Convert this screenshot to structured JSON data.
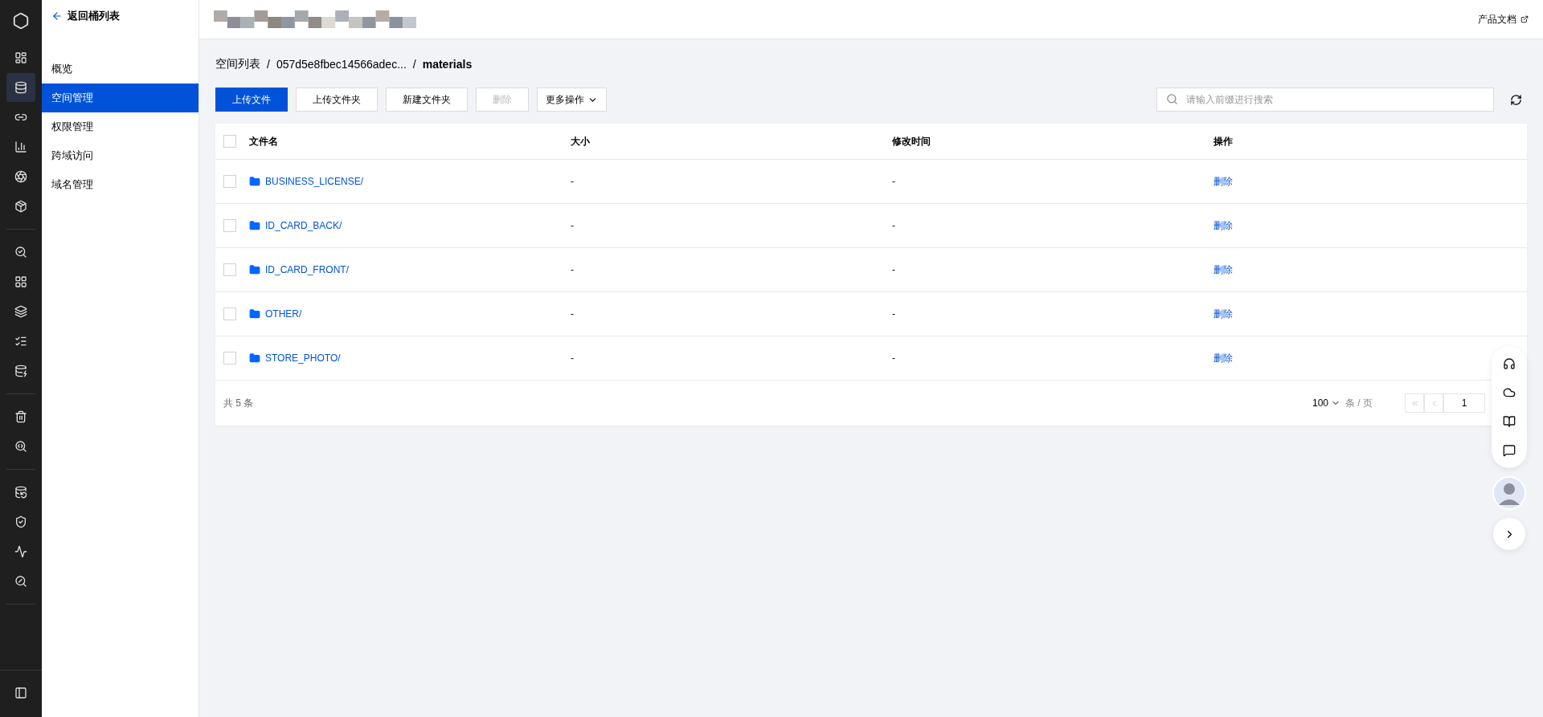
{
  "rail_groups": [
    [
      {
        "selected": false
      },
      {
        "selected": true
      },
      {
        "selected": false
      },
      {
        "selected": false
      },
      {
        "selected": false
      },
      {
        "selected": false
      }
    ],
    [
      {
        "selected": false
      },
      {
        "selected": false
      },
      {
        "selected": false
      },
      {
        "selected": false
      },
      {
        "selected": false
      }
    ],
    [
      {
        "selected": false
      },
      {
        "selected": false
      }
    ],
    [
      {
        "selected": false
      },
      {
        "selected": false
      },
      {
        "selected": false
      },
      {
        "selected": false
      }
    ]
  ],
  "sidebar": {
    "back_label": "返回桶列表",
    "items": [
      {
        "label": "概览",
        "selected": false
      },
      {
        "label": "空间管理",
        "selected": true
      },
      {
        "label": "权限管理",
        "selected": false
      },
      {
        "label": "跨域访问",
        "selected": false
      },
      {
        "label": "域名管理",
        "selected": false
      }
    ]
  },
  "header": {
    "docs_link": "产品文档"
  },
  "breadcrumb": [
    {
      "kind": "link",
      "text": "空间列表"
    },
    {
      "kind": "separator",
      "text": "/"
    },
    {
      "kind": "link",
      "text": "057d5e8fbec14566adec..."
    },
    {
      "kind": "separator",
      "text": "/"
    },
    {
      "kind": "current",
      "text": "materials"
    }
  ],
  "toolbar": {
    "buttons": [
      {
        "label": "上传文件",
        "primary": true,
        "disabled": false
      },
      {
        "label": "上传文件夹",
        "primary": false,
        "disabled": false
      },
      {
        "label": "新建文件夹",
        "primary": false,
        "disabled": false
      },
      {
        "label": "删除",
        "primary": false,
        "disabled": true
      }
    ],
    "more_label": "更多操作",
    "search_placeholder": "请输入前缀进行搜索"
  },
  "table": {
    "all_checked": false,
    "columns": [
      "文件名",
      "大小",
      "修改时间",
      "操作"
    ],
    "rows": [
      {
        "name": "BUSINESS_LICENSE/",
        "size": "-",
        "modified": "-",
        "action": "删除",
        "checked": false
      },
      {
        "name": "ID_CARD_BACK/",
        "size": "-",
        "modified": "-",
        "action": "删除",
        "checked": false
      },
      {
        "name": "ID_CARD_FRONT/",
        "size": "-",
        "modified": "-",
        "action": "删除",
        "checked": false
      },
      {
        "name": "OTHER/",
        "size": "-",
        "modified": "-",
        "action": "删除",
        "checked": false
      },
      {
        "name": "STORE_PHOTO/",
        "size": "-",
        "modified": "-",
        "action": "删除",
        "checked": false
      }
    ]
  },
  "footer": {
    "total": "共 5 条",
    "page_size": "100",
    "page_size_unit": "条 / 页",
    "page": "1"
  }
}
